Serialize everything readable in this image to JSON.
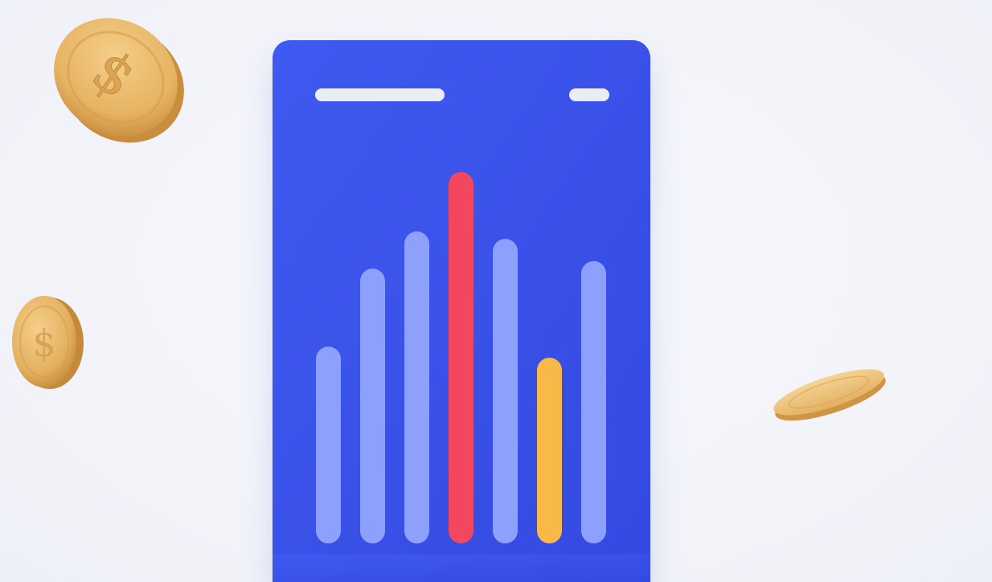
{
  "colors": {
    "background": "#f4f5fb",
    "card": "#3c54e9",
    "bar_default": "#8da0fb",
    "bar_highlight_peak": "#f2475f",
    "bar_highlight_low": "#f9b949",
    "header_line": "#ebedf5",
    "coin": "#e9b867"
  },
  "chart_data": {
    "type": "bar",
    "categories": [
      "",
      "",
      "",
      "",
      "",
      "",
      ""
    ],
    "values": [
      0.53,
      0.74,
      0.84,
      1.0,
      0.82,
      0.5,
      0.76
    ],
    "highlights": {
      "3": "peak",
      "5": "low"
    },
    "title": "",
    "xlabel": "",
    "ylabel": "",
    "ylim": [
      0,
      1
    ],
    "grid": false
  },
  "icons": {
    "header_line_long": "placeholder-title-line",
    "header_line_short": "placeholder-tag-line",
    "coin_top_left": "dollar-coin-icon",
    "coin_left": "coin-icon",
    "coin_right": "coin-icon"
  }
}
